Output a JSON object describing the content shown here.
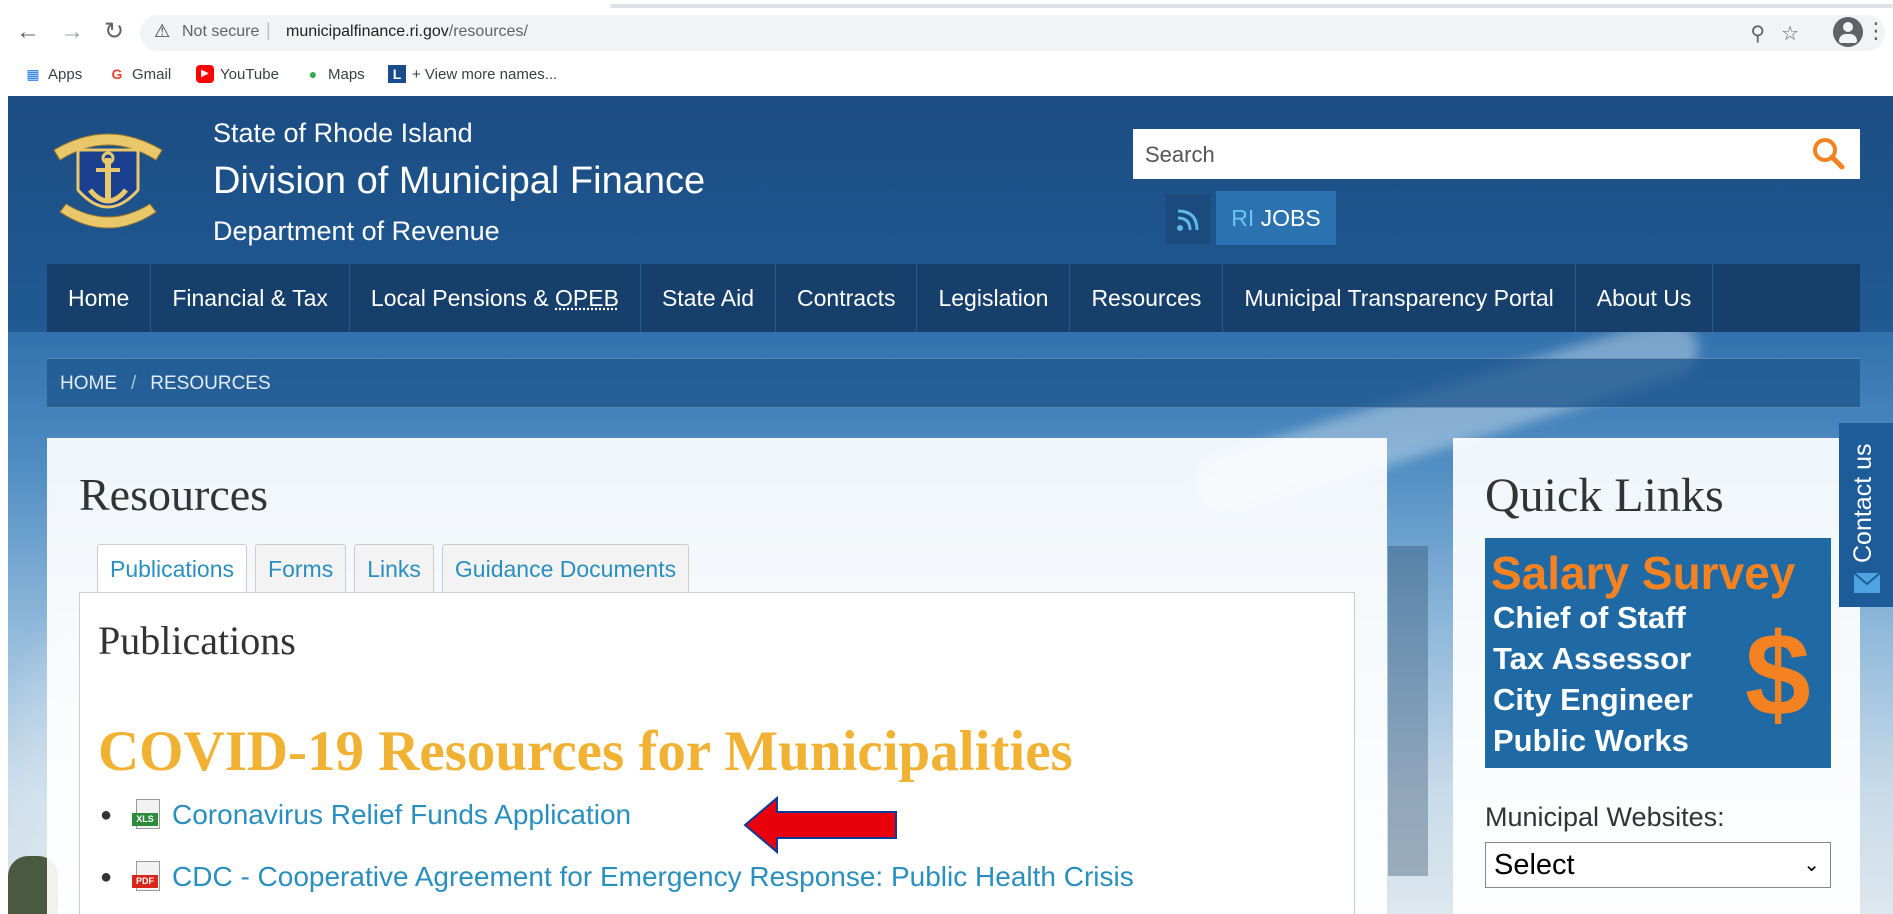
{
  "browser": {
    "warning": "Not secure",
    "url_host": "municipalfinance.ri.gov",
    "url_path": "/resources/",
    "bookmarks": [
      "Apps",
      "Gmail",
      "YouTube",
      "Maps",
      "+ View more names..."
    ]
  },
  "header": {
    "line1": "State of Rhode Island",
    "line2": "Division of Municipal Finance",
    "line3": "Department of Revenue",
    "search_placeholder": "Search",
    "ri_prefix": "RI",
    "jobs": "JOBS"
  },
  "nav": {
    "items": [
      "Home",
      "Financial & Tax",
      "Local Pensions & ",
      "State Aid",
      "Contracts",
      "Legislation",
      "Resources",
      "Municipal Transparency Portal",
      "About Us"
    ],
    "opeb": "OPEB"
  },
  "breadcrumb": {
    "home": "HOME",
    "sep": "/",
    "current": "RESOURCES"
  },
  "main": {
    "title": "Resources",
    "tabs": [
      "Publications",
      "Forms",
      "Links",
      "Guidance Documents"
    ],
    "section_title": "Publications",
    "covid_title": "COVID-19 Resources for Municipalities",
    "documents": [
      {
        "label": "Coronavirus Relief Funds Application",
        "type": "XLS"
      },
      {
        "label": "CDC - Cooperative Agreement for Emergency Response: Public Health Crisis",
        "type": "PDF"
      }
    ]
  },
  "sidebar": {
    "title": "Quick Links",
    "salary_heading": "Salary Survey",
    "salary_lines": [
      "Chief of Staff",
      "Tax Assessor",
      "City Engineer",
      "Public Works"
    ],
    "salary_symbol": "$",
    "muni_label": "Municipal Websites:",
    "muni_selected": "Select"
  },
  "contact": {
    "label": "Contact us"
  },
  "colors": {
    "header_blue": "#1b4d83",
    "nav_blue": "#173f6c",
    "link_blue": "#2a8fbf",
    "covid_gold": "#f1b133",
    "salary_orange": "#f58220",
    "arrow_red": "#e8000b"
  }
}
